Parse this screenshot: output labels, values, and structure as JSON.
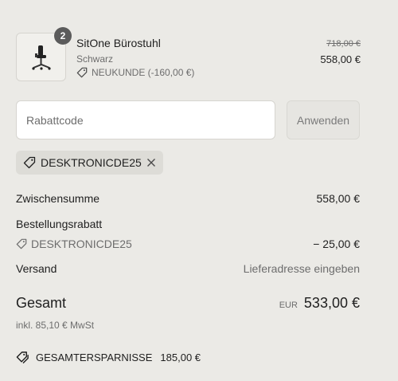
{
  "product": {
    "quantity": "2",
    "name": "SitOne Bürostuhl",
    "variant": "Schwarz",
    "discount_label": "NEUKUNDE (-160,00 €)",
    "original_price": "718,00 €",
    "price": "558,00 €",
    "image_icon": "office-chair-icon"
  },
  "discount_form": {
    "placeholder": "Rabattcode",
    "apply_label": "Anwenden"
  },
  "applied_code": {
    "code": "DESKTRONICDE25"
  },
  "summary": {
    "subtotal_label": "Zwischensumme",
    "subtotal_value": "558,00 €",
    "order_discount_label": "Bestellungsrabatt",
    "order_discount_code": "DESKTRONICDE25",
    "order_discount_value": "− 25,00 €",
    "shipping_label": "Versand",
    "shipping_value": "Lieferadresse eingeben",
    "total_label": "Gesamt",
    "total_currency": "EUR",
    "total_value": "533,00 €",
    "tax_note": "inkl. 85,10 € MwSt",
    "savings_label": "GESAMTERSPARNISSE",
    "savings_value": "185,00 €"
  },
  "colors": {
    "background": "#ebeae6",
    "text": "#1f1f1f",
    "muted": "#6d6d6d",
    "badge": "#5b5b5b"
  }
}
